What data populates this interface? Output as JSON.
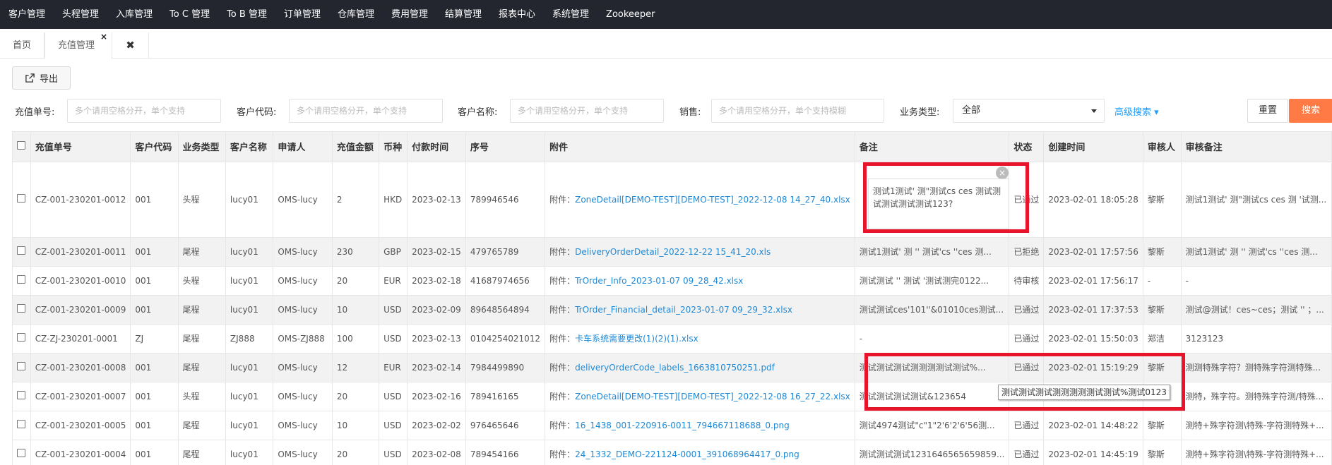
{
  "topnav": [
    "客户管理",
    "头程管理",
    "入库管理",
    "To C 管理",
    "To B 管理",
    "订单管理",
    "仓库管理",
    "费用管理",
    "结算管理",
    "报表中心",
    "系统管理",
    "Zookeeper"
  ],
  "tabs": {
    "home": "首页",
    "active": "充值管理",
    "close_icon": "×",
    "close_all": "✖"
  },
  "export_label": "导出",
  "filters": {
    "order_no_label": "充值单号:",
    "order_no_placeholder": "多个请用空格分开，单个支持",
    "cust_code_label": "客户代码:",
    "cust_code_placeholder": "多个请用空格分开，单个支持",
    "cust_name_label": "客户名称:",
    "cust_name_placeholder": "多个请用空格分开，单个支持",
    "sales_label": "销售:",
    "sales_placeholder": "多个请用空格分开，单个支持模糊",
    "biz_type_label": "业务类型:",
    "biz_type_value": "全部",
    "advanced": "高级搜索",
    "reset": "重置",
    "search": "搜索"
  },
  "table": {
    "headers": [
      "充值单号",
      "客户代码",
      "业务类型",
      "客户名称",
      "申请人",
      "充值金额",
      "币种",
      "付款时间",
      "序号",
      "附件",
      "备注",
      "状态",
      "创建时间",
      "审核人",
      "审核备注"
    ],
    "attach_prefix": "附件：",
    "rows": [
      {
        "no": "CZ-001-230201-0012",
        "code": "001",
        "type": "头程",
        "name": "lucy01",
        "applicant": "OMS-lucy",
        "amount": "2",
        "currency": "HKD",
        "paytime": "2023-02-13",
        "seq": "789946546",
        "file": "ZoneDetail[DEMO-TEST][DEMO-TEST]_2022-12-08 14_27_40.xlsx",
        "remark": "",
        "status": "已通过",
        "created": "2023-02-01 18:05:28",
        "auditor": "黎斯",
        "audit_note": "测试1测试'   测\"测试cs ces 测 '试测..."
      },
      {
        "no": "CZ-001-230201-0011",
        "code": "001",
        "type": "尾程",
        "name": "lucy01",
        "applicant": "OMS-lucy",
        "amount": "230",
        "currency": "GBP",
        "paytime": "2023-02-15",
        "seq": "479765789",
        "file": "DeliveryOrderDetail_2022-12-22 15_41_20.xls",
        "remark": "测试1测试'   测  ''  测试'cs ''ces 测...",
        "status": "已拒绝",
        "created": "2023-02-01 17:57:56",
        "auditor": "黎斯",
        "audit_note": "测试1测试'   测  ''  测试'cs ''ces 测..."
      },
      {
        "no": "CZ-001-230201-0010",
        "code": "001",
        "type": "头程",
        "name": "lucy01",
        "applicant": "OMS-lucy",
        "amount": "20",
        "currency": "EUR",
        "paytime": "2023-02-18",
        "seq": "41687974656",
        "file": "TrOrder_Info_2023-01-07 09_28_42.xlsx",
        "remark": "测试测试  ''  测试  '测试测完0122...",
        "status": "待审核",
        "created": "2023-02-01 17:56:17",
        "auditor": "-",
        "audit_note": "-"
      },
      {
        "no": "CZ-001-230201-0009",
        "code": "001",
        "type": "尾程",
        "name": "lucy01",
        "applicant": "OMS-lucy",
        "amount": "10",
        "currency": "USD",
        "paytime": "2023-02-09",
        "seq": "89648564894",
        "file": "TrOrder_Financial_detail_2023-01-07 09_29_32.xlsx",
        "remark": "测试测试ces'101''&01010ces测试...",
        "status": "已通过",
        "created": "2023-02-01 17:37:53",
        "auditor": "黎斯",
        "audit_note": "测试@测试！ces~ces；测试  ''  ；..."
      },
      {
        "no": "CZ-ZJ-230201-0001",
        "code": "ZJ",
        "type": "尾程",
        "name": "ZJ888",
        "applicant": "OMS-ZJ888",
        "amount": "100",
        "currency": "USD",
        "paytime": "2023-02-13",
        "seq": "0104254021012",
        "file": "卡车系统需要更改(1)(2)(1).xlsx",
        "remark": "-",
        "status": "已通过",
        "created": "2023-02-01 15:50:03",
        "auditor": "郑洁",
        "audit_note": "3123123"
      },
      {
        "no": "CZ-001-230201-0008",
        "code": "001",
        "type": "尾程",
        "name": "lucy01",
        "applicant": "OMS-lucy",
        "amount": "12",
        "currency": "EUR",
        "paytime": "2023-02-14",
        "seq": "7984499890",
        "file": "deliveryOrderCode_labels_1663810750251.pdf",
        "remark": "测试测试测试测测测测试测试%...",
        "status": "已通过",
        "created": "2023-02-01 15:19:29",
        "auditor": "黎斯",
        "audit_note": "测测特殊字符？测特殊字符测特殊..."
      },
      {
        "no": "CZ-001-230201-0007",
        "code": "001",
        "type": "头程",
        "name": "lucy01",
        "applicant": "OMS-lucy",
        "amount": "20",
        "currency": "USD",
        "paytime": "2023-02-16",
        "seq": "789416165",
        "file": "ZoneDetail[DEMO-TEST][DEMO-TEST]_2022-12-08 16_27_22.xlsx",
        "remark": "测试测试测试测试&123654",
        "status": "",
        "created": "",
        "auditor": "",
        "audit_note": "测特，殊字符。测特殊字符测/特殊..."
      },
      {
        "no": "CZ-001-230201-0005",
        "code": "001",
        "type": "尾程",
        "name": "lucy01",
        "applicant": "OMS-lucy",
        "amount": "10",
        "currency": "USD",
        "paytime": "2023-02-02",
        "seq": "976465646",
        "file": "16_1438_001-220916-0011_794667118688_0.png",
        "remark": "测试4974测试\"c\"1\"2'6'2'6'56测...",
        "status": "已通过",
        "created": "2023-02-01 14:48:22",
        "auditor": "黎斯",
        "audit_note": "测特+殊字符测\\特殊-字符测特殊+..."
      },
      {
        "no": "CZ-001-230201-0004",
        "code": "001",
        "type": "尾程",
        "name": "lucy01",
        "applicant": "OMS-lucy",
        "amount": "20",
        "currency": "USD",
        "paytime": "2023-02-08",
        "seq": "789454166",
        "file": "24_1332_DEMO-221124-0001_391068964417_0.png",
        "remark": "测试测试测试1231646565659859...",
        "status": "已通过",
        "created": "2023-02-01 14:45:19",
        "auditor": "黎斯",
        "audit_note": "测特+殊字符测\\特殊-字符测特殊+..."
      }
    ]
  },
  "note_popup": {
    "text": "测试1测试'   测\"测试cs ces 测试测试测试测试测试123?",
    "close": "×"
  },
  "tooltip": "测试测试测试测测测测测试测试%测试0123",
  "colors": {
    "topnav": "#23262e",
    "search": "#ff7a45",
    "link": "#1e88d6",
    "highlight": "#e8142b"
  }
}
